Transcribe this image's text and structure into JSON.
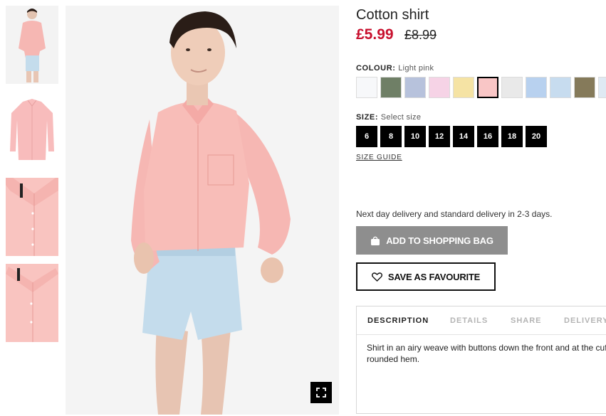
{
  "product": {
    "title": "Cotton shirt",
    "price_current": "£5.99",
    "price_old": "£8.99"
  },
  "colour": {
    "label": "COLOUR:",
    "selected": "Light pink",
    "swatches": [
      {
        "name": "White",
        "color": "#f7f8fa"
      },
      {
        "name": "Khaki green",
        "color": "#6f7f66"
      },
      {
        "name": "Blue striped",
        "color": "#b7c2dc"
      },
      {
        "name": "Pink striped",
        "color": "#f6d3e6"
      },
      {
        "name": "Light yellow",
        "color": "#f5e3a4"
      },
      {
        "name": "Light pink",
        "color": "#f9c6c6"
      },
      {
        "name": "Black/white striped",
        "color": "#e9e9e9"
      },
      {
        "name": "Light blue striped",
        "color": "#b8d1ef"
      },
      {
        "name": "Light blue",
        "color": "#c7dcef"
      },
      {
        "name": "Olive",
        "color": "#857a5a"
      },
      {
        "name": "Pale blue",
        "color": "#dfe9f3"
      }
    ]
  },
  "size": {
    "label": "SIZE:",
    "selected": "Select size",
    "options": [
      "6",
      "8",
      "10",
      "12",
      "14",
      "16",
      "18",
      "20"
    ],
    "guide_label": "SIZE GUIDE"
  },
  "delivery_note": "Next day delivery and standard delivery in 2-3 days.",
  "buttons": {
    "add_to_bag": "ADD TO SHOPPING BAG",
    "save_favourite": "SAVE AS FAVOURITE"
  },
  "tabs": [
    {
      "label": "DESCRIPTION",
      "active": true
    },
    {
      "label": "DETAILS",
      "active": false
    },
    {
      "label": "SHARE",
      "active": false
    },
    {
      "label": "DELIVERY",
      "active": false
    }
  ],
  "description": "Shirt in an airy weave with buttons down the front and at the cuffs, and a rounded hem.",
  "colors": {
    "sale_red": "#c8102e",
    "bag_button": "#8e8e8e",
    "shirt_pink": "#f6b7b3",
    "denim_blue": "#c4dcec"
  },
  "icons": {
    "bag": "shopping-bag-icon",
    "heart": "heart-icon",
    "fullscreen": "fullscreen-icon"
  }
}
